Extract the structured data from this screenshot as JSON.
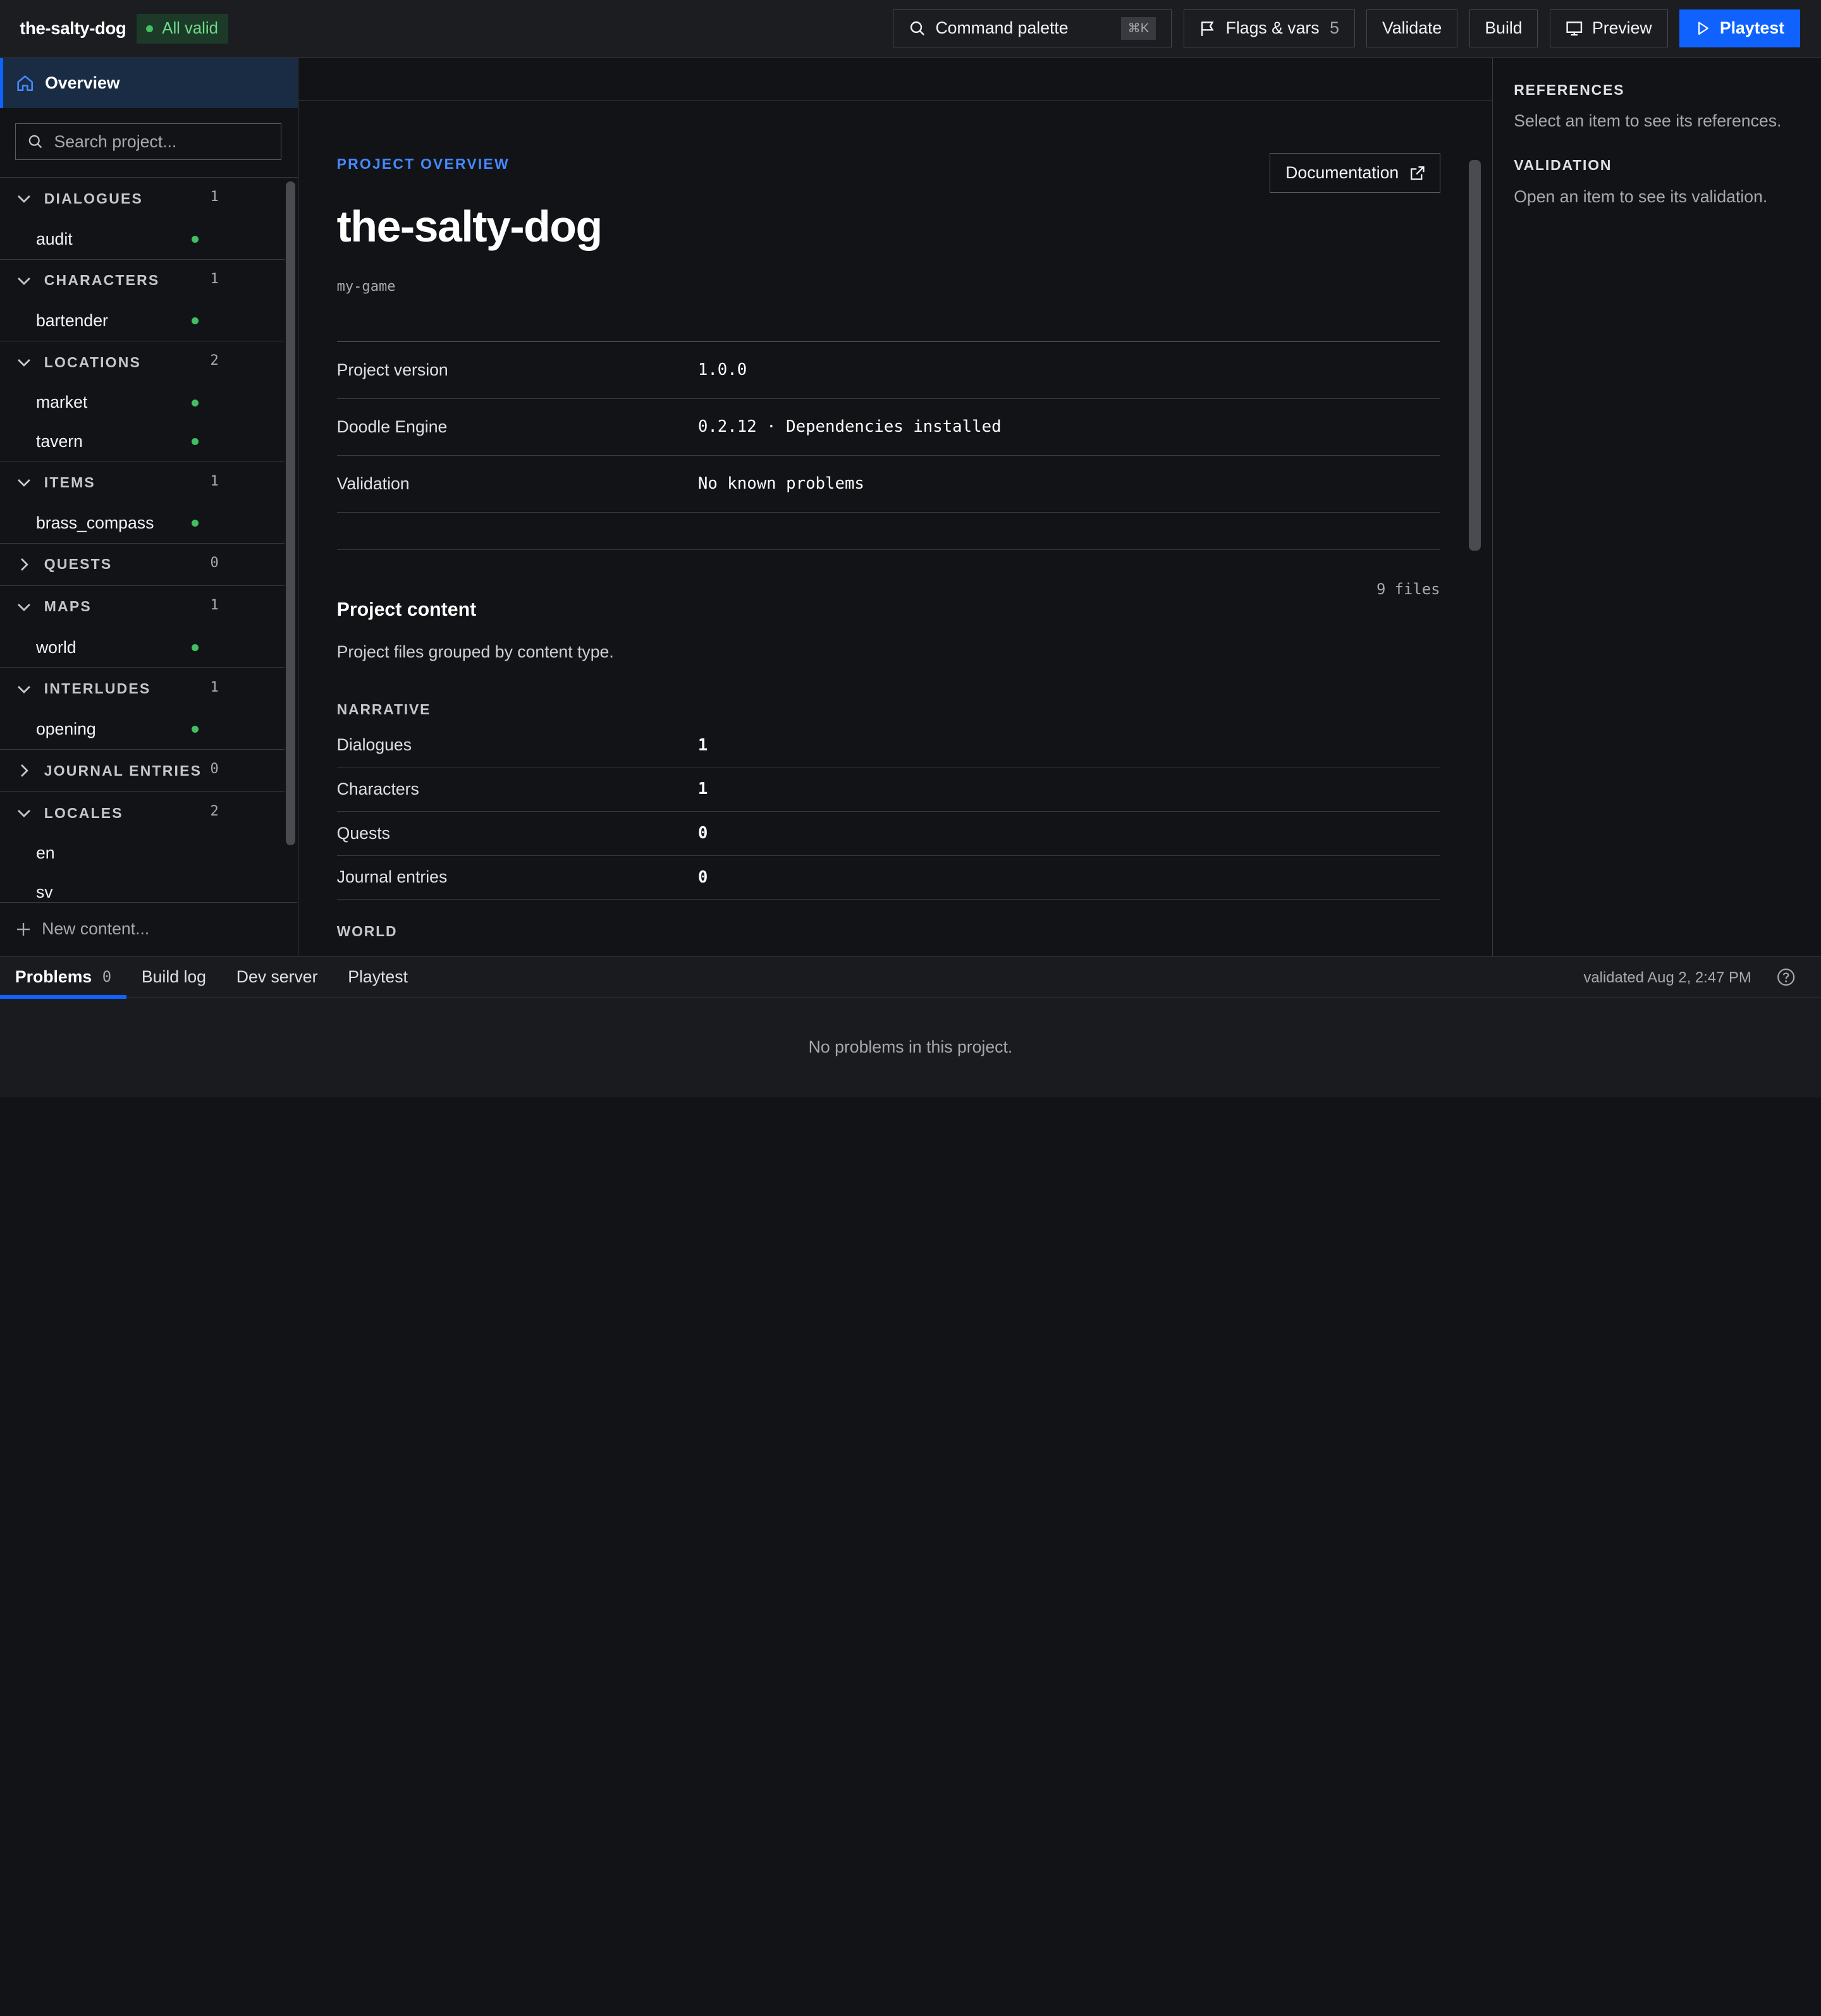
{
  "topbar": {
    "project_name": "the-salty-dog",
    "status_label": "All valid",
    "command_palette_label": "Command palette",
    "command_palette_shortcut": "⌘K",
    "flags_label": "Flags & vars",
    "flags_count": "5",
    "validate_label": "Validate",
    "build_label": "Build",
    "preview_label": "Preview",
    "playtest_label": "Playtest"
  },
  "sidebar": {
    "overview_label": "Overview",
    "search_placeholder": "Search project...",
    "groups": [
      {
        "label": "DIALOGUES",
        "count": "1",
        "expanded": true,
        "items": [
          {
            "label": "audit",
            "valid": true
          }
        ]
      },
      {
        "label": "CHARACTERS",
        "count": "1",
        "expanded": true,
        "items": [
          {
            "label": "bartender",
            "valid": true
          }
        ]
      },
      {
        "label": "LOCATIONS",
        "count": "2",
        "expanded": true,
        "items": [
          {
            "label": "market",
            "valid": true
          },
          {
            "label": "tavern",
            "valid": true
          }
        ]
      },
      {
        "label": "ITEMS",
        "count": "1",
        "expanded": true,
        "items": [
          {
            "label": "brass_compass",
            "valid": true
          }
        ]
      },
      {
        "label": "QUESTS",
        "count": "0",
        "expanded": false,
        "items": []
      },
      {
        "label": "MAPS",
        "count": "1",
        "expanded": true,
        "items": [
          {
            "label": "world",
            "valid": true
          }
        ]
      },
      {
        "label": "INTERLUDES",
        "count": "1",
        "expanded": true,
        "items": [
          {
            "label": "opening",
            "valid": true
          }
        ]
      },
      {
        "label": "JOURNAL ENTRIES",
        "count": "0",
        "expanded": false,
        "items": []
      },
      {
        "label": "LOCALES",
        "count": "2",
        "expanded": true,
        "items": [
          {
            "label": "en",
            "valid": false
          },
          {
            "label": "sv",
            "valid": false
          }
        ]
      }
    ],
    "new_content_label": "New content..."
  },
  "main": {
    "eyebrow": "PROJECT OVERVIEW",
    "documentation_label": "Documentation",
    "title": "the-salty-dog",
    "slug": "my-game",
    "properties": [
      {
        "key": "Project version",
        "value": "1.0.0"
      },
      {
        "key": "Doodle Engine",
        "value": "0.2.12 · Dependencies installed"
      },
      {
        "key": "Validation",
        "value": "No known problems"
      }
    ],
    "files_count": "9 files",
    "content_title": "Project content",
    "content_desc": "Project files grouped by content type.",
    "narrative_label": "NARRATIVE",
    "narrative_rows": [
      {
        "key": "Dialogues",
        "value": "1"
      },
      {
        "key": "Characters",
        "value": "1"
      },
      {
        "key": "Quests",
        "value": "0"
      },
      {
        "key": "Journal entries",
        "value": "0"
      }
    ],
    "world_label": "WORLD"
  },
  "right_panel": {
    "references_title": "REFERENCES",
    "references_text": "Select an item to see its references.",
    "validation_title": "VALIDATION",
    "validation_text": "Open an item to see its validation."
  },
  "bottom": {
    "tabs": [
      {
        "label": "Problems",
        "count": "0",
        "active": true
      },
      {
        "label": "Build log",
        "active": false
      },
      {
        "label": "Dev server",
        "active": false
      },
      {
        "label": "Playtest",
        "active": false
      }
    ],
    "validated_text": "validated Aug 2, 2:47 PM",
    "empty_text": "No problems in this project."
  },
  "colors": {
    "accent": "#0f62fe",
    "valid": "#42be65",
    "background": "#121316"
  }
}
